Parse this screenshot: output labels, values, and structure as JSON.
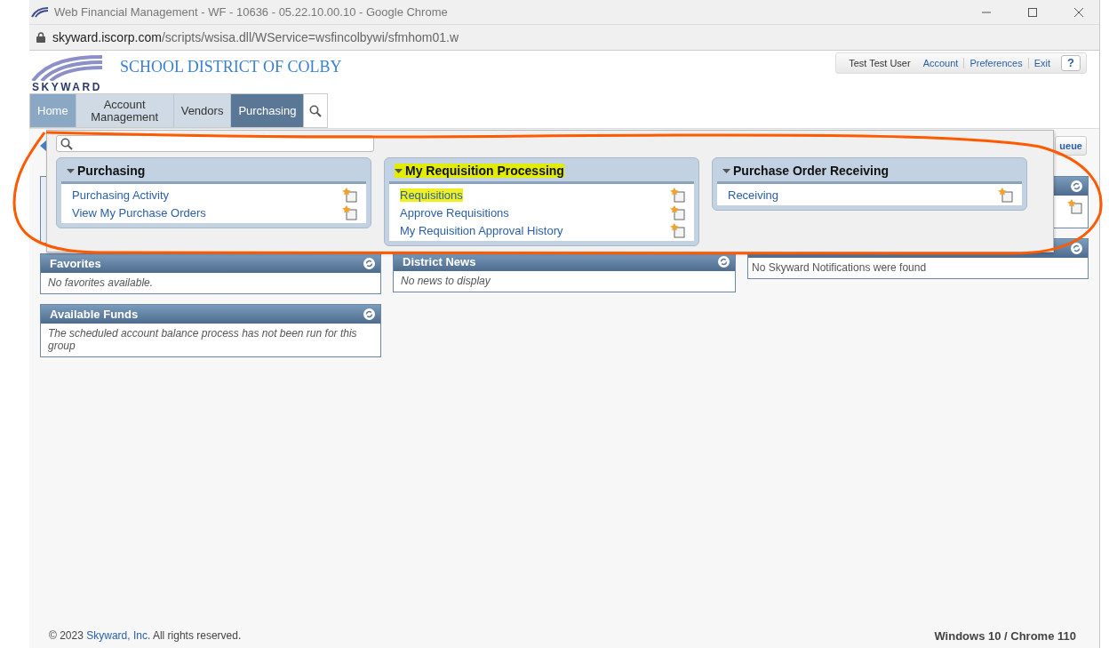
{
  "browser": {
    "title": "Web Financial Management - WF - 10636 - 05.22.10.00.10 - Google Chrome",
    "url_host": "skyward.iscorp.com",
    "url_path": "/scripts/wsisa.dll/WService=wsfincolbywi/sfmhom01.w"
  },
  "header": {
    "logo": "SKYWARD",
    "district": "SCHOOL DISTRICT OF COLBY",
    "user": "Test Test User",
    "links": [
      "Account",
      "Preferences",
      "Exit"
    ],
    "help": "?"
  },
  "tabs": [
    {
      "label": "Home",
      "selected": false,
      "current": true
    },
    {
      "label": "Account Management",
      "selected": false,
      "current": false
    },
    {
      "label": "Vendors",
      "selected": false,
      "current": false
    },
    {
      "label": "Purchasing",
      "selected": true,
      "current": false
    }
  ],
  "menu": {
    "groups": [
      {
        "title": "Purchasing",
        "highlighted": false,
        "items": [
          {
            "label": "Purchasing Activity",
            "highlighted": false
          },
          {
            "label": "View My Purchase Orders",
            "highlighted": false
          }
        ]
      },
      {
        "title": "My Requisition Processing",
        "highlighted": true,
        "items": [
          {
            "label": "Requisitions",
            "highlighted": true
          },
          {
            "label": "Approve Requisitions",
            "highlighted": false
          },
          {
            "label": "My Requisition Approval History",
            "highlighted": false
          }
        ]
      },
      {
        "title": "Purchase Order Receiving",
        "highlighted": false,
        "items": [
          {
            "label": "Receiving",
            "highlighted": false
          }
        ]
      }
    ]
  },
  "dashboard": {
    "queue_button": "ueue",
    "columns": [
      [
        {
          "title": "Favorites",
          "body": "No favorites available."
        },
        {
          "title": "Available Funds",
          "body": "The scheduled account balance process has not been run for this group"
        }
      ],
      [
        {
          "title": "District News",
          "body": "No news to display"
        }
      ],
      [
        {
          "body": "No Skyward Notifications were found"
        }
      ]
    ]
  },
  "footer": {
    "before": "© 2023 ",
    "link": "Skyward, Inc.",
    "after": " All rights reserved.",
    "platform": "Windows 10 / Chrome 110"
  }
}
